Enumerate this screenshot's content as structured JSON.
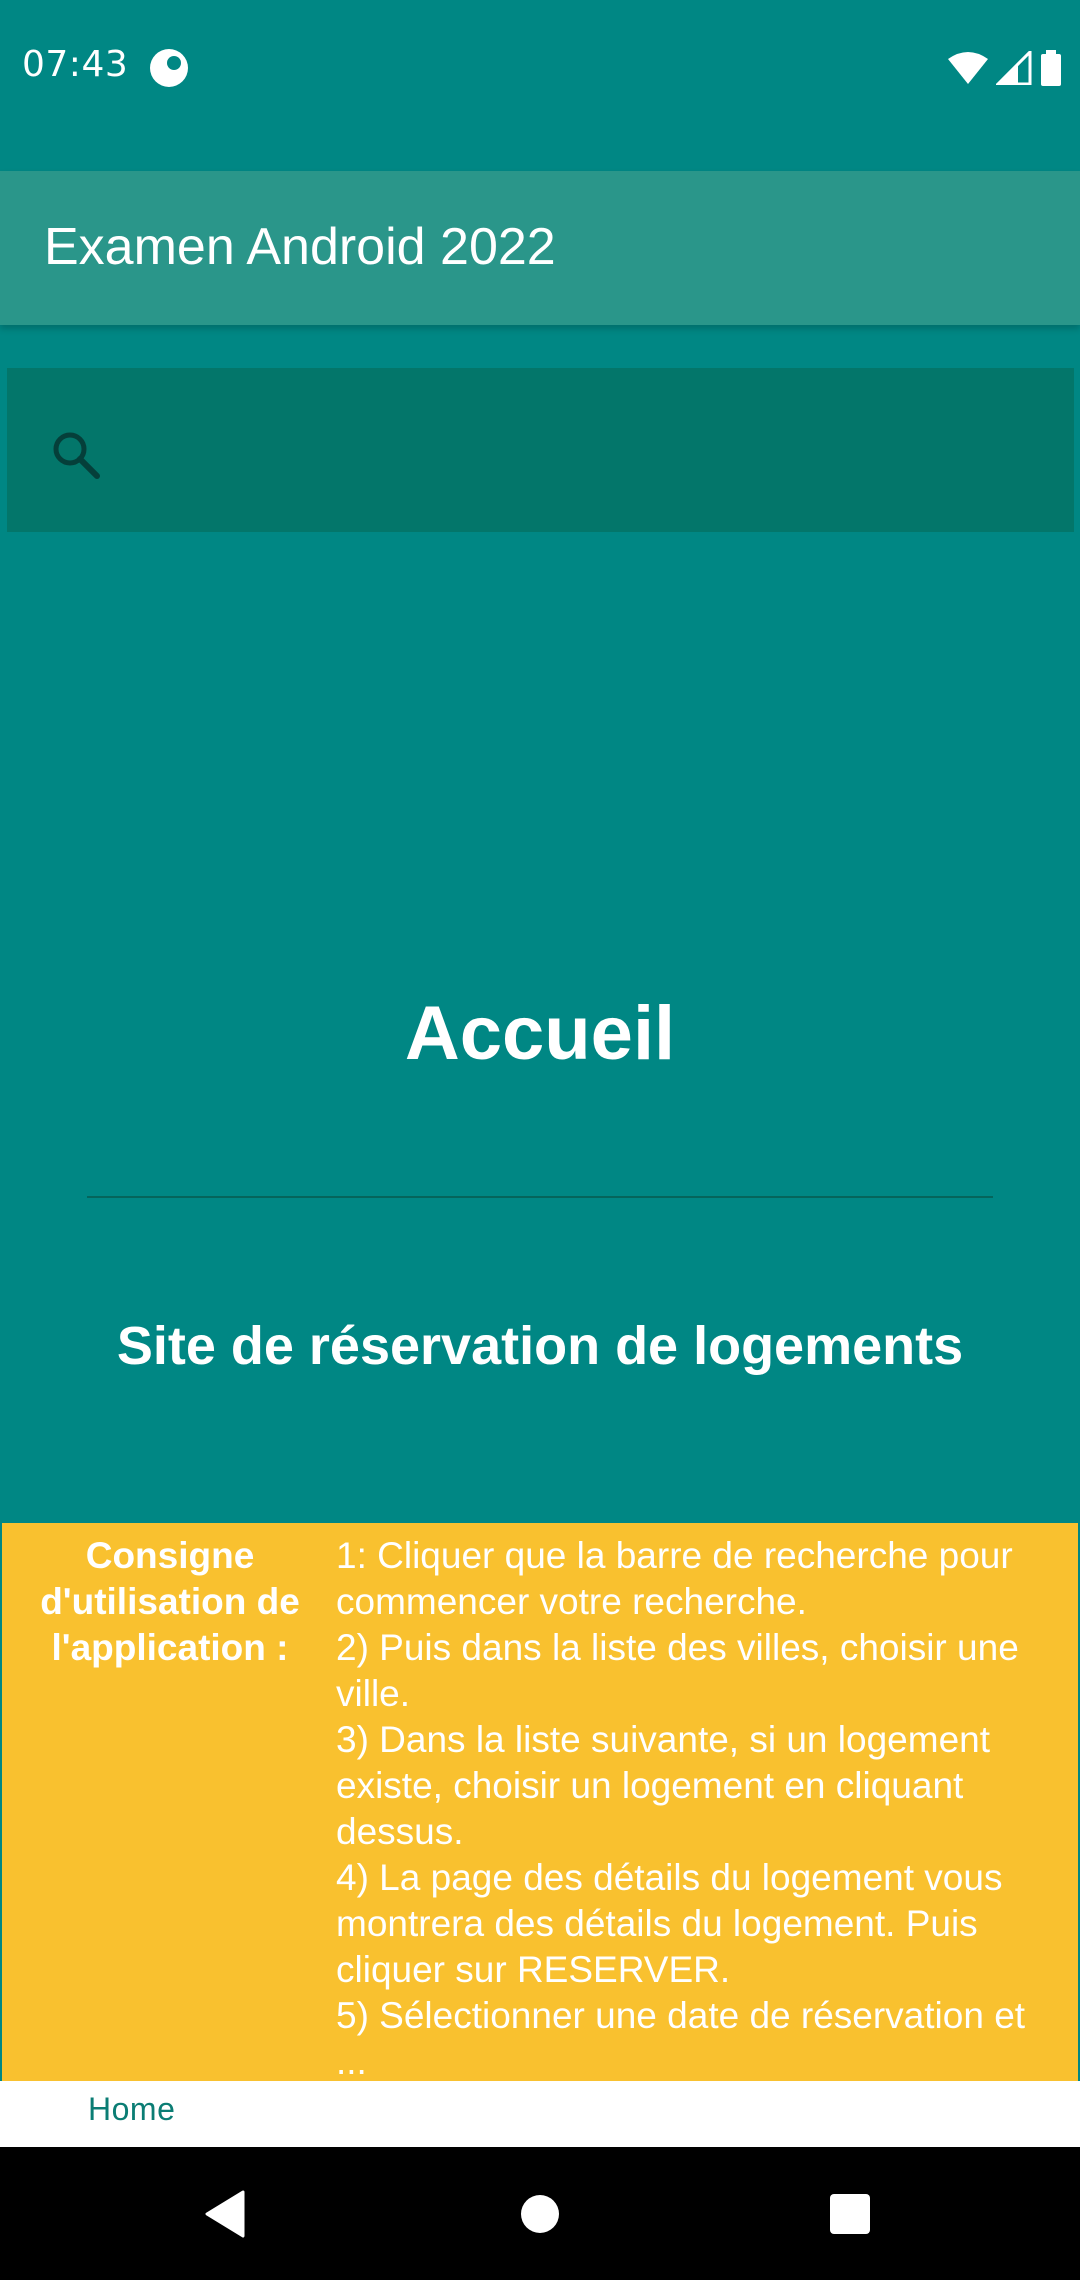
{
  "status_bar": {
    "time": "07:43",
    "icons": [
      "app-notification-icon",
      "wifi-icon",
      "signal-icon",
      "battery-icon"
    ]
  },
  "app_bar": {
    "title": "Examen Android 2022"
  },
  "search": {
    "placeholder": "",
    "value": ""
  },
  "main": {
    "heading": "Accueil",
    "subtitle": "Site de réservation de logements"
  },
  "instructions": {
    "label": "Consigne d'utilisation de l'application :",
    "steps": [
      "1: Cliquer que la barre de recherche pour commencer votre recherche.",
      "2) Puis dans la liste des villes, choisir une ville.",
      "3) Dans la liste suivante, si un logement existe, choisir un logement en cliquant dessus.",
      "4) La page des détails du logement vous montrera des détails du logement. Puis cliquer sur RESERVER.",
      "5) Sélectionner une date de réservation et ..."
    ]
  },
  "bottom_tabs": {
    "home_label": "Home"
  },
  "nav": {
    "buttons": [
      "back-icon",
      "home-icon",
      "recents-icon"
    ]
  },
  "colors": {
    "background": "#008784",
    "app_bar": "#2a968a",
    "search_bar": "#03766a",
    "instructions_panel": "#f9c12f",
    "tab_text": "#0b7d74"
  }
}
